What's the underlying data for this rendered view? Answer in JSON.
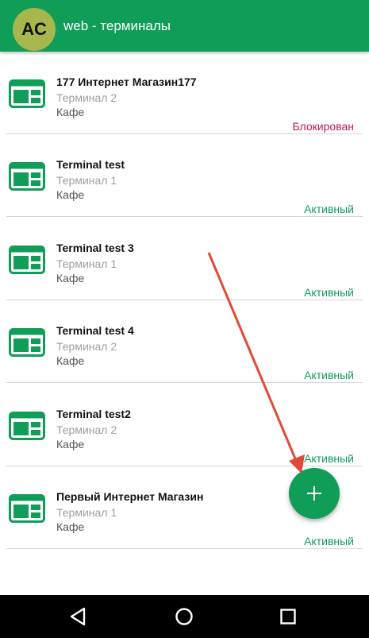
{
  "header": {
    "avatar_text": "AC",
    "title": "web - терминалы"
  },
  "colors": {
    "primary": "#0f9d58",
    "avatar": "#a7b64d",
    "status_active": "#0f9d58",
    "status_blocked": "#c2185b",
    "annotation_arrow": "#e04a3a"
  },
  "terminals": [
    {
      "name": "177 Интернет Магазин177",
      "terminal": "Терминал 2",
      "category": "Кафе",
      "status": "Блокирован",
      "status_type": "blocked",
      "icon": "terminal-icon"
    },
    {
      "name": "Terminal test",
      "terminal": "Терминал 1",
      "category": "Кафе",
      "status": "Активный",
      "status_type": "active",
      "icon": "terminal-icon"
    },
    {
      "name": "Terminal test 3",
      "terminal": "Терминал 1",
      "category": "Кафе",
      "status": "Активный",
      "status_type": "active",
      "icon": "terminal-icon"
    },
    {
      "name": "Terminal test 4",
      "terminal": "Терминал 2",
      "category": "Кафе",
      "status": "Активный",
      "status_type": "active",
      "icon": "terminal-icon"
    },
    {
      "name": "Terminal test2",
      "terminal": "Терминал 2",
      "category": "Кафе",
      "status": "Активный",
      "status_type": "active",
      "icon": "terminal-icon"
    },
    {
      "name": "Первый Интернет Магазин",
      "terminal": "Терминал 1",
      "category": "Кафе",
      "status": "Активный",
      "status_type": "active",
      "icon": "terminal-icon"
    }
  ],
  "fab": {
    "icon": "plus-icon"
  },
  "navbar": {
    "icons": [
      "back-icon",
      "home-icon",
      "recents-icon"
    ]
  }
}
